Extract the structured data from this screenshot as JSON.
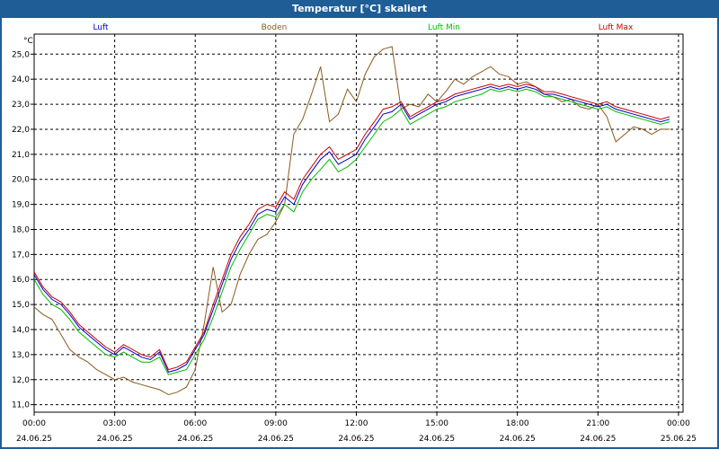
{
  "window": {
    "title": "Temperatur [°C] skaliert"
  },
  "chart_data": {
    "type": "line",
    "title": "Temperatur [°C] skaliert",
    "ylabel": "°C",
    "ylim": [
      10.7,
      25.8
    ],
    "xlim_hours": [
      0,
      24.17
    ],
    "grid": true,
    "y_ticks": [
      "25,0",
      "24,0",
      "23,0",
      "22,0",
      "21,0",
      "20,0",
      "19,0",
      "18,0",
      "17,0",
      "16,0",
      "15,0",
      "14,0",
      "13,0",
      "12,0",
      "11,0"
    ],
    "x_ticks": [
      {
        "time": "00:00",
        "date": "24.06.25"
      },
      {
        "time": "03:00",
        "date": "24.06.25"
      },
      {
        "time": "06:00",
        "date": "24.06.25"
      },
      {
        "time": "09:00",
        "date": "24.06.25"
      },
      {
        "time": "12:00",
        "date": "24.06.25"
      },
      {
        "time": "15:00",
        "date": "24.06.25"
      },
      {
        "time": "18:00",
        "date": "24.06.25"
      },
      {
        "time": "21:00",
        "date": "24.06.25"
      },
      {
        "time": "00:00",
        "date": "25.06.25"
      }
    ],
    "series": [
      {
        "name": "Luft",
        "color": "#0000cc",
        "x": [
          0,
          0.33,
          0.67,
          1,
          1.33,
          1.67,
          2,
          2.33,
          2.67,
          3,
          3.33,
          3.67,
          4,
          4.33,
          4.67,
          5,
          5.33,
          5.67,
          6,
          6.33,
          6.67,
          7,
          7.33,
          7.67,
          8,
          8.33,
          8.67,
          9,
          9.33,
          9.67,
          10,
          10.33,
          10.67,
          11,
          11.33,
          11.67,
          12,
          12.33,
          12.67,
          13,
          13.33,
          13.67,
          14,
          14.33,
          14.67,
          15,
          15.33,
          15.67,
          16,
          16.33,
          16.67,
          17,
          17.33,
          17.67,
          18,
          18.33,
          18.67,
          19,
          19.33,
          19.67,
          20,
          20.33,
          20.67,
          21,
          21.33,
          21.67,
          22,
          22.33,
          22.67,
          23,
          23.33,
          23.67
        ],
        "y": [
          16.2,
          15.6,
          15.2,
          15.0,
          14.6,
          14.1,
          13.8,
          13.5,
          13.2,
          13.0,
          13.3,
          13.1,
          12.9,
          12.8,
          13.1,
          12.3,
          12.4,
          12.6,
          13.2,
          13.8,
          14.8,
          15.8,
          16.8,
          17.5,
          18.0,
          18.6,
          18.8,
          18.7,
          19.3,
          19.0,
          19.8,
          20.3,
          20.8,
          21.1,
          20.6,
          20.8,
          21.0,
          21.6,
          22.1,
          22.6,
          22.7,
          23.0,
          22.4,
          22.6,
          22.8,
          23.0,
          23.1,
          23.3,
          23.4,
          23.5,
          23.6,
          23.7,
          23.6,
          23.7,
          23.6,
          23.7,
          23.6,
          23.4,
          23.4,
          23.3,
          23.2,
          23.1,
          23.0,
          22.9,
          23.0,
          22.8,
          22.7,
          22.6,
          22.5,
          22.4,
          22.3,
          22.4
        ]
      },
      {
        "name": "Boden",
        "color": "#8b5a1e",
        "x": [
          0,
          0.33,
          0.67,
          1,
          1.33,
          1.67,
          2,
          2.33,
          2.67,
          3,
          3.33,
          3.67,
          4,
          4.33,
          4.67,
          5,
          5.33,
          5.67,
          6,
          6.33,
          6.67,
          7,
          7.33,
          7.67,
          8,
          8.33,
          8.67,
          9,
          9.33,
          9.67,
          10,
          10.33,
          10.67,
          11,
          11.33,
          11.67,
          12,
          12.33,
          12.67,
          13,
          13.33,
          13.67,
          14,
          14.33,
          14.67,
          15,
          15.33,
          15.67,
          16,
          16.33,
          16.67,
          17,
          17.33,
          17.67,
          18,
          18.33,
          18.67,
          19,
          19.33,
          19.67,
          20,
          20.33,
          20.67,
          21,
          21.33,
          21.67,
          22,
          22.33,
          22.67,
          23,
          23.33,
          23.67
        ],
        "y": [
          14.9,
          14.6,
          14.4,
          13.8,
          13.2,
          12.9,
          12.7,
          12.4,
          12.2,
          12.0,
          12.1,
          11.9,
          11.8,
          11.7,
          11.6,
          11.4,
          11.5,
          11.7,
          12.4,
          14.2,
          16.5,
          14.7,
          15.0,
          16.2,
          17.0,
          17.6,
          17.8,
          18.3,
          19.0,
          21.8,
          22.4,
          23.4,
          24.5,
          22.3,
          22.6,
          23.6,
          23.1,
          24.2,
          24.9,
          25.2,
          25.3,
          22.8,
          23.0,
          22.9,
          23.4,
          23.1,
          23.5,
          24.0,
          23.8,
          24.1,
          24.3,
          24.5,
          24.2,
          24.1,
          23.8,
          23.9,
          23.7,
          23.4,
          23.3,
          23.1,
          23.2,
          22.9,
          22.8,
          23.0,
          22.5,
          21.5,
          21.8,
          22.1,
          22.0,
          21.8,
          22.0,
          22.0
        ]
      },
      {
        "name": "Luft Min",
        "color": "#00bb00",
        "x": [
          0,
          0.33,
          0.67,
          1,
          1.33,
          1.67,
          2,
          2.33,
          2.67,
          3,
          3.33,
          3.67,
          4,
          4.33,
          4.67,
          5,
          5.33,
          5.67,
          6,
          6.33,
          6.67,
          7,
          7.33,
          7.67,
          8,
          8.33,
          8.67,
          9,
          9.33,
          9.67,
          10,
          10.33,
          10.67,
          11,
          11.33,
          11.67,
          12,
          12.33,
          12.67,
          13,
          13.33,
          13.67,
          14,
          14.33,
          14.67,
          15,
          15.33,
          15.67,
          16,
          16.33,
          16.67,
          17,
          17.33,
          17.67,
          18,
          18.33,
          18.67,
          19,
          19.33,
          19.67,
          20,
          20.33,
          20.67,
          21,
          21.33,
          21.67,
          22,
          22.33,
          22.67,
          23,
          23.33,
          23.67
        ],
        "y": [
          16.0,
          15.4,
          15.0,
          14.8,
          14.4,
          13.9,
          13.6,
          13.3,
          13.0,
          12.9,
          13.1,
          12.9,
          12.7,
          12.7,
          12.9,
          12.2,
          12.3,
          12.4,
          13.0,
          13.6,
          14.5,
          15.5,
          16.5,
          17.2,
          17.8,
          18.4,
          18.6,
          18.5,
          19.0,
          18.7,
          19.5,
          20.0,
          20.4,
          20.8,
          20.3,
          20.5,
          20.8,
          21.3,
          21.8,
          22.3,
          22.5,
          22.8,
          22.2,
          22.4,
          22.6,
          22.8,
          22.9,
          23.1,
          23.2,
          23.3,
          23.4,
          23.6,
          23.5,
          23.6,
          23.5,
          23.6,
          23.5,
          23.3,
          23.3,
          23.2,
          23.1,
          23.0,
          22.9,
          22.8,
          22.9,
          22.7,
          22.6,
          22.5,
          22.4,
          22.3,
          22.2,
          22.3
        ]
      },
      {
        "name": "Luft Max",
        "color": "#cc0000",
        "x": [
          0,
          0.33,
          0.67,
          1,
          1.33,
          1.67,
          2,
          2.33,
          2.67,
          3,
          3.33,
          3.67,
          4,
          4.33,
          4.67,
          5,
          5.33,
          5.67,
          6,
          6.33,
          6.67,
          7,
          7.33,
          7.67,
          8,
          8.33,
          8.67,
          9,
          9.33,
          9.67,
          10,
          10.33,
          10.67,
          11,
          11.33,
          11.67,
          12,
          12.33,
          12.67,
          13,
          13.33,
          13.67,
          14,
          14.33,
          14.67,
          15,
          15.33,
          15.67,
          16,
          16.33,
          16.67,
          17,
          17.33,
          17.67,
          18,
          18.33,
          18.67,
          19,
          19.33,
          19.67,
          20,
          20.33,
          20.67,
          21,
          21.33,
          21.67,
          22,
          22.33,
          22.67,
          23,
          23.33,
          23.67
        ],
        "y": [
          16.3,
          15.7,
          15.3,
          15.1,
          14.7,
          14.2,
          13.9,
          13.6,
          13.3,
          13.1,
          13.4,
          13.2,
          13.0,
          12.9,
          13.2,
          12.4,
          12.5,
          12.7,
          13.3,
          13.9,
          15.0,
          16.0,
          17.0,
          17.7,
          18.2,
          18.8,
          19.0,
          18.9,
          19.5,
          19.2,
          20.0,
          20.5,
          21.0,
          21.3,
          20.8,
          21.0,
          21.2,
          21.8,
          22.3,
          22.8,
          22.9,
          23.1,
          22.5,
          22.7,
          22.9,
          23.1,
          23.2,
          23.4,
          23.5,
          23.6,
          23.7,
          23.8,
          23.7,
          23.8,
          23.7,
          23.8,
          23.7,
          23.5,
          23.5,
          23.4,
          23.3,
          23.2,
          23.1,
          23.0,
          23.1,
          22.9,
          22.8,
          22.7,
          22.6,
          22.5,
          22.4,
          22.5
        ]
      }
    ],
    "legend_placement": "top"
  }
}
